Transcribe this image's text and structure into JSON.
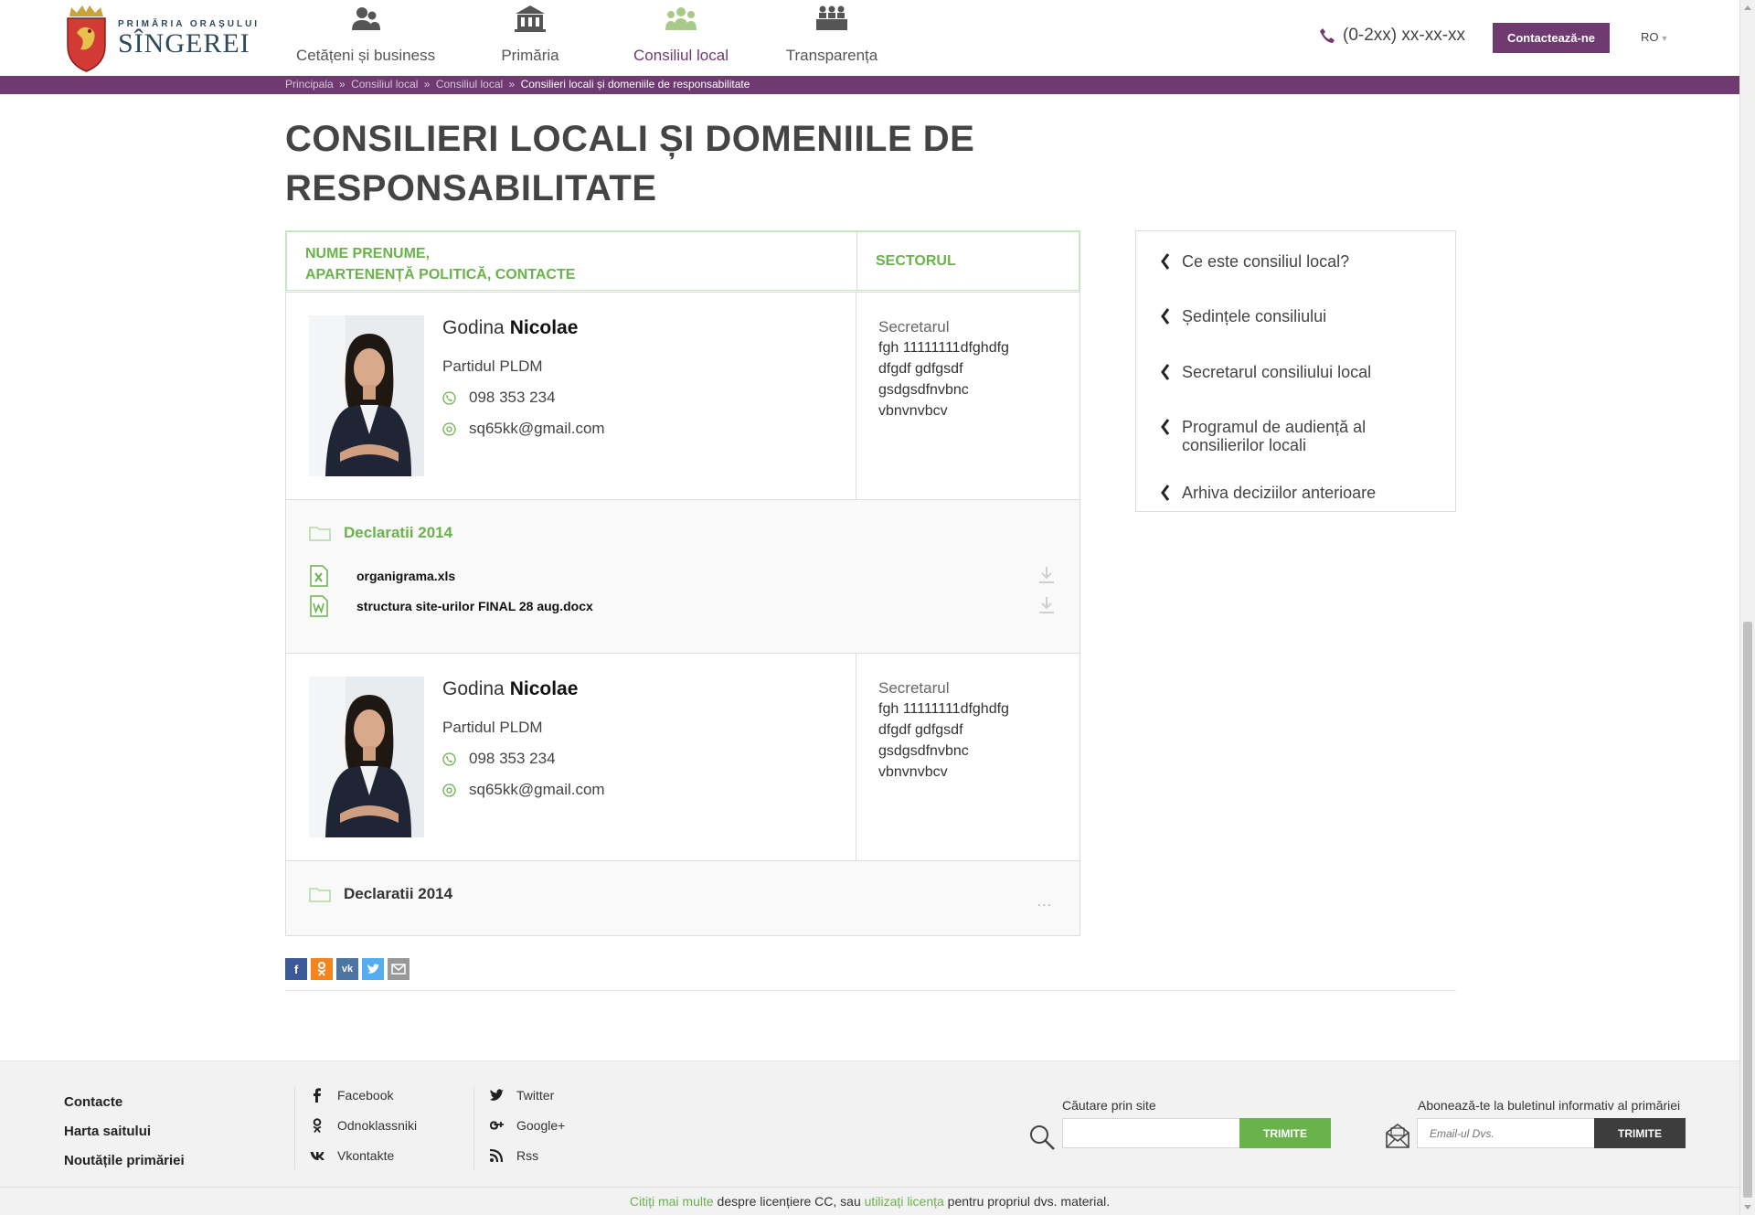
{
  "header": {
    "logo_top": "PRIMĂRIA ORAȘULUI",
    "logo_main": "SÎNGEREI",
    "nav": [
      {
        "label": "Cetățeni și business",
        "icon": "citizens-icon"
      },
      {
        "label": "Primăria",
        "icon": "city-hall-icon"
      },
      {
        "label": "Consiliul local",
        "icon": "council-icon",
        "active": true
      },
      {
        "label": "Transparența",
        "icon": "transparency-icon"
      }
    ],
    "phone": "(0-2xx) xx-xx-xx",
    "contact_button": "Contactează-ne",
    "language": "RO"
  },
  "breadcrumb": {
    "items": [
      "Principala",
      "Consiliul local",
      "Consiliul local"
    ],
    "separator": "»",
    "current": "Consilieri locali și domeniile de responsabilitate"
  },
  "page_title": "CONSILIERI LOCALI ȘI DOMENIILE DE RESPONSABILITATE",
  "table": {
    "col1_line1": "NUME PRENUME,",
    "col1_line2": "APARTENENȚĂ POLITICĂ, CONTACTE",
    "col2": "SECTORUL",
    "rows": [
      {
        "first": "Godina",
        "last": "Nicolae",
        "party": "Partidul PLDM",
        "phone": "098 353 234",
        "email": "sq65kk@gmail.com",
        "role": "Secretarul",
        "sector_lines": [
          "fgh 11111111dfghdfg",
          "dfgdf gdfgsdf",
          "gsdgsdfnvbnc",
          "vbnvnvbcv"
        ],
        "folder": "Declaratii 2014",
        "files": [
          {
            "name": "organigrama.xls",
            "type": "excel"
          },
          {
            "name": "structura site-urilor FINAL 28 aug.docx",
            "type": "word"
          }
        ]
      },
      {
        "first": "Godina",
        "last": "Nicolae",
        "party": "Partidul PLDM",
        "phone": "098 353 234",
        "email": "sq65kk@gmail.com",
        "role": "Secretarul",
        "sector_lines": [
          "fgh 11111111dfghdfg",
          "dfgdf gdfgsdf",
          "gsdgsdfnvbnc",
          "vbnvnvbcv"
        ],
        "folder": "Declaratii 2014",
        "more": "..."
      }
    ]
  },
  "sidebar": {
    "items": [
      "Ce este consiliul local?",
      "Ședințele consiliului",
      "Secretarul consiliului local",
      "Programul de audiență al consilierilor locali",
      "Arhiva deciziilor anterioare"
    ]
  },
  "share": [
    "facebook",
    "odnoklassniki",
    "vkontakte",
    "twitter",
    "email"
  ],
  "footer": {
    "links": [
      "Contacte",
      "Harta saitului",
      "Noutățile primăriei"
    ],
    "social_col1": [
      "Facebook",
      "Odnoklassniki",
      "Vkontakte"
    ],
    "social_col2": [
      "Twitter",
      "Google+",
      "Rss"
    ],
    "search_label": "Căutare prin site",
    "search_button": "TRIMITE",
    "subscribe_label": "Abonează-te la buletinul informativ al primăriei",
    "subscribe_placeholder": "Email-ul Dvs.",
    "subscribe_button": "TRIMITE",
    "license_link1": "Citiți mai multe",
    "license_mid": " despre licențiere CC, sau ",
    "license_link2": "utilizați licența",
    "license_end": " pentru propriul dvs. material."
  },
  "colors": {
    "brand_purple": "#6e3a6f",
    "accent_green": "#6ab24b",
    "header_border_green": "#c7e4c4",
    "dark_button": "#3d3d3d"
  }
}
